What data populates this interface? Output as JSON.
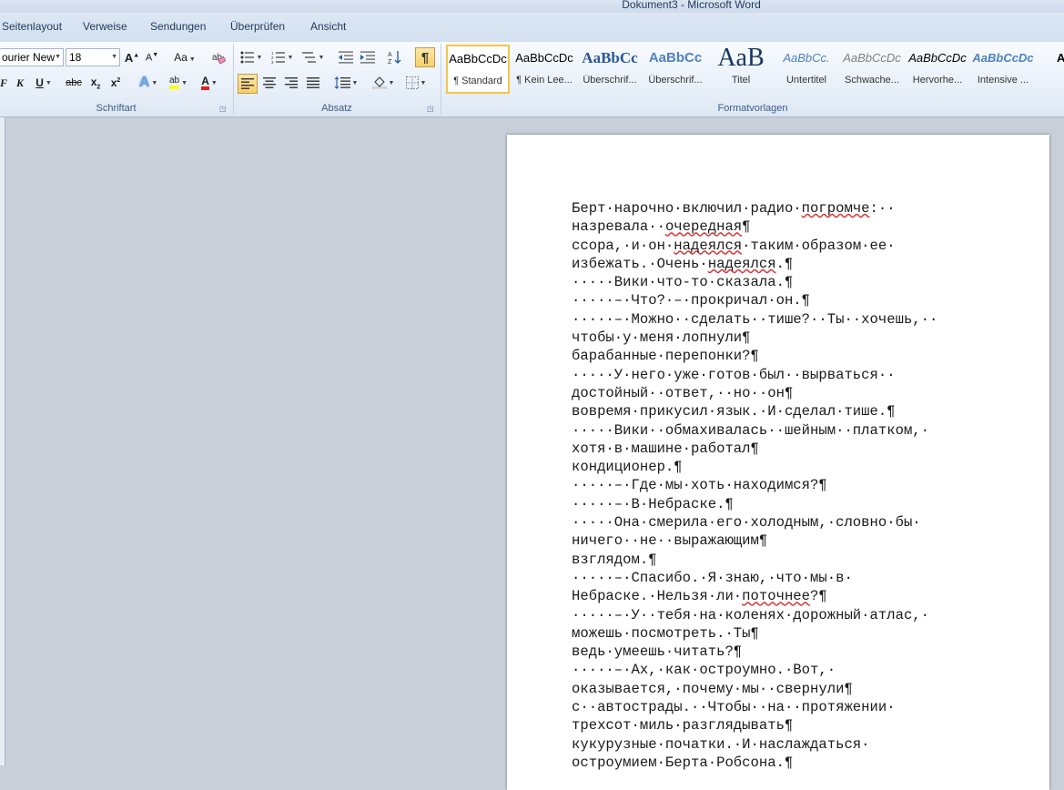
{
  "window": {
    "title": "Dokument3 - Microsoft Word"
  },
  "tabs": [
    "Seitenlayout",
    "Verweise",
    "Sendungen",
    "Überprüfen",
    "Ansicht"
  ],
  "font_group": {
    "label": "Schriftart",
    "font_name": "ourier New",
    "font_size": "18"
  },
  "paragraph_group": {
    "label": "Absatz"
  },
  "styles_group": {
    "label": "Formatvorlagen",
    "tiles": [
      {
        "preview": "AaBbCcDc",
        "name": "¶ Standard"
      },
      {
        "preview": "AaBbCcDc",
        "name": "¶ Kein Lee..."
      },
      {
        "preview": "AaBbCc",
        "name": "Überschrif..."
      },
      {
        "preview": "AaBbCc",
        "name": "Überschrif..."
      },
      {
        "preview": "AaB",
        "name": "Titel"
      },
      {
        "preview": "AaBbCc.",
        "name": "Untertitel"
      },
      {
        "preview": "AaBbCcDc",
        "name": "Schwache..."
      },
      {
        "preview": "AaBbCcDc",
        "name": "Hervorhe..."
      },
      {
        "preview": "AaBbCcDc",
        "name": "Intensive ..."
      },
      {
        "preview": "AaB",
        "name": "F"
      }
    ]
  },
  "document": {
    "lines": [
      "Берт·нарочно·включил·радио·погромче:··",
      "назревала··очередная¶",
      "ссора,·и·он·надеялся·таким·образом·ее·",
      "избежать.·Очень·надеялся.¶",
      "·····Вики·что-то·сказала.¶",
      "·····–·Что?·–·прокричал·он.¶",
      "·····–·Можно··сделать··тише?··Ты··хочешь,··",
      "чтобы·у·меня·лопнули¶",
      "барабанные·перепонки?¶",
      "·····У·него·уже·готов·был··вырваться··",
      "достойный··ответ,··но··он¶",
      "вовремя·прикусил·язык.·И·сделал·тише.¶",
      "·····Вики··обмахивалась··шейным··платком,·",
      "хотя·в·машине·работал¶",
      "кондиционер.¶",
      "·····–·Где·мы·хоть·находимся?¶",
      "·····–·В·Небраске.¶",
      "·····Она·смерила·его·холодным,·словно·бы·",
      "ничего··не··выражающим¶",
      "взглядом.¶",
      "·····–·Спасибо.·Я·знаю,·что·мы·в·",
      "Небраске.·Нельзя·ли·поточнее?¶",
      "·····–·У··тебя·на·коленях·дорожный·атлас,·",
      "можешь·посмотреть.·Ты¶",
      "ведь·умеешь·читать?¶",
      "·····–·Ах,·как·остроумно.·Вот,·",
      "оказывается,·почему·мы··свернули¶",
      "с··автострады.··Чтобы··на··протяжении·",
      "трехсот·миль·разглядывать¶",
      "кукурузные·початки.·И·наслаждаться·",
      "остроумием·Берта·Робсона.¶"
    ]
  }
}
